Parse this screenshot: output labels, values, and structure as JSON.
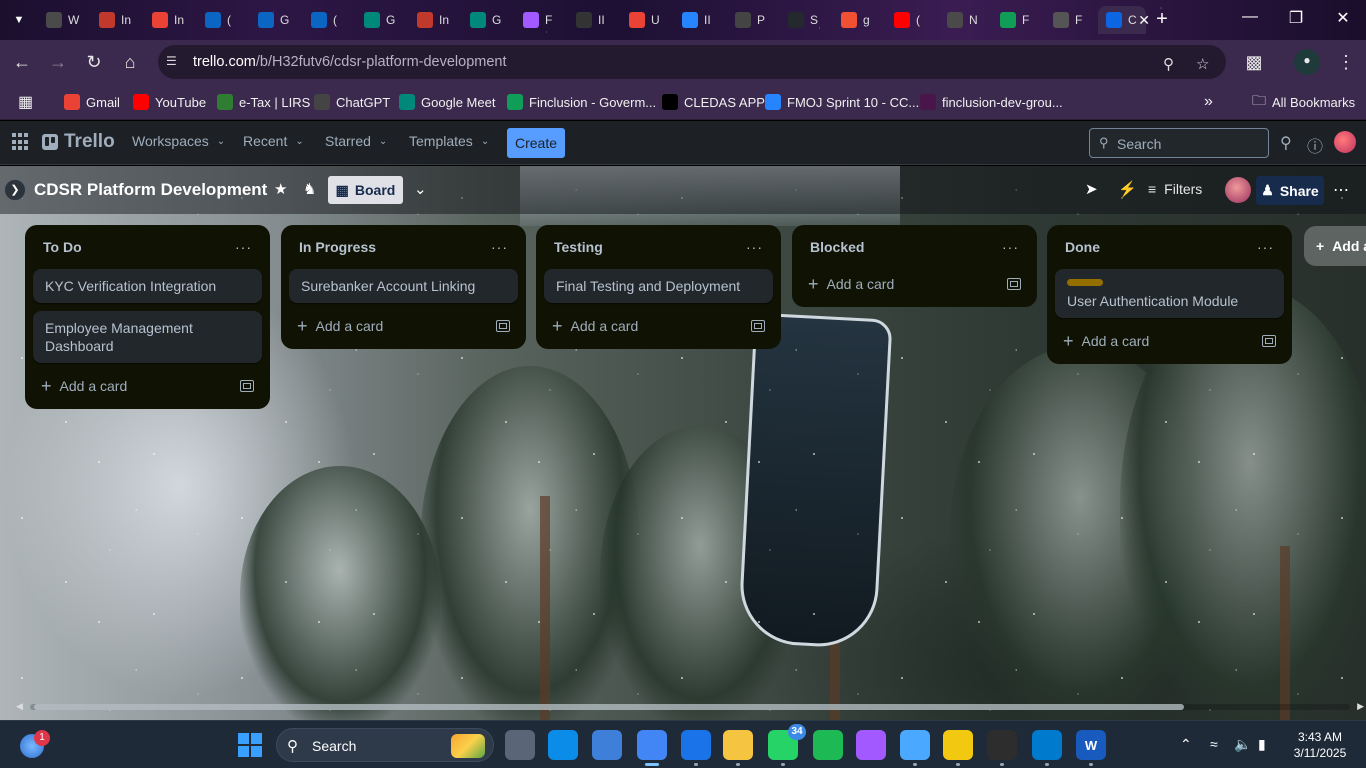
{
  "browser": {
    "tabs": [
      {
        "icon": "chrome-icon",
        "label": "W",
        "color": "#4a4a4a"
      },
      {
        "icon": "speedometer-icon",
        "label": "In",
        "color": "#c0392b"
      },
      {
        "icon": "gmail-icon",
        "label": "In",
        "color": "#ea4335"
      },
      {
        "icon": "linkedin-icon",
        "label": "(",
        "color": "#0a66c2"
      },
      {
        "icon": "linkedin-icon",
        "label": "G",
        "color": "#0a66c2"
      },
      {
        "icon": "linkedin-icon",
        "label": "(",
        "color": "#0a66c2"
      },
      {
        "icon": "google-meet-icon",
        "label": "G",
        "color": "#00897b"
      },
      {
        "icon": "speedometer-icon",
        "label": "In",
        "color": "#c0392b"
      },
      {
        "icon": "google-meet-icon",
        "label": "G",
        "color": "#00897b"
      },
      {
        "icon": "figma-icon",
        "label": "F",
        "color": "#a259ff"
      },
      {
        "icon": "notion-icon",
        "label": "II",
        "color": "#333333"
      },
      {
        "icon": "gmail-icon",
        "label": "U",
        "color": "#ea4335"
      },
      {
        "icon": "jira-icon",
        "label": "II",
        "color": "#2684ff"
      },
      {
        "icon": "openai-icon",
        "label": "P",
        "color": "#444444"
      },
      {
        "icon": "github-icon",
        "label": "S",
        "color": "#24292e"
      },
      {
        "icon": "git-icon",
        "label": "g",
        "color": "#f05133"
      },
      {
        "icon": "youtube-icon",
        "label": "(",
        "color": "#ff0000"
      },
      {
        "icon": "chrome-icon",
        "label": "N",
        "color": "#4a4a4a"
      },
      {
        "icon": "sheets-icon",
        "label": "F",
        "color": "#0f9d58"
      },
      {
        "icon": "trello-icon",
        "label": "F",
        "color": "#555555"
      },
      {
        "icon": "trello-icon",
        "label": "C",
        "color": "#0c66e4"
      }
    ],
    "new_tab_label": "+",
    "url_domain": "trello.com",
    "url_path": "/b/H32futv6/cdsr-platform-development",
    "bookmarks": [
      {
        "icon": "gmail-icon",
        "label": "Gmail",
        "color": "#ea4335"
      },
      {
        "icon": "youtube-icon",
        "label": "YouTube",
        "color": "#ff0000"
      },
      {
        "icon": "etax-icon",
        "label": "e-Tax | LIRS",
        "color": "#2e7d32"
      },
      {
        "icon": "openai-icon",
        "label": "ChatGPT",
        "color": "#444444"
      },
      {
        "icon": "google-meet-icon",
        "label": "Google Meet",
        "color": "#00897b"
      },
      {
        "icon": "sheets-icon",
        "label": "Finclusion - Goverm...",
        "color": "#0f9d58"
      },
      {
        "icon": "vercel-icon",
        "label": "CLEDAS APP",
        "color": "#000000"
      },
      {
        "icon": "jira-icon",
        "label": "FMOJ Sprint 10 - CC...",
        "color": "#2684ff"
      },
      {
        "icon": "slack-icon",
        "label": "finclusion-dev-grou...",
        "color": "#4a154b"
      }
    ],
    "more_bookmarks": "»",
    "all_bookmarks": "All Bookmarks"
  },
  "trello": {
    "logo": "Trello",
    "menu": [
      "Workspaces",
      "Recent",
      "Starred",
      "Templates"
    ],
    "create": "Create",
    "search_placeholder": "Search"
  },
  "board": {
    "title": "CDSR Platform Development",
    "view": "Board",
    "filters": "Filters",
    "share": "Share",
    "add_list": "Add a",
    "lists": [
      {
        "title": "To Do",
        "cards": [
          {
            "title": "KYC Verification Integration",
            "label_color": null
          },
          {
            "title": "Employee Management Dashboard",
            "label_color": null
          }
        ],
        "add_card": "Add a card"
      },
      {
        "title": "In Progress",
        "cards": [
          {
            "title": "Surebanker Account Linking",
            "label_color": null
          }
        ],
        "add_card": "Add a card"
      },
      {
        "title": "Testing",
        "cards": [
          {
            "title": "Final Testing and Deployment",
            "label_color": null
          }
        ],
        "add_card": "Add a card"
      },
      {
        "title": "Blocked",
        "cards": [],
        "add_card": "Add a card"
      },
      {
        "title": "Done",
        "cards": [
          {
            "title": "User Authentication Module",
            "label_color": "#946f00"
          }
        ],
        "add_card": "Add a card"
      }
    ]
  },
  "taskbar": {
    "weather_badge": "1",
    "search": "Search",
    "apps": [
      {
        "icon": "task-view-icon",
        "label": "",
        "color": "#5a6678"
      },
      {
        "icon": "edge-icon",
        "label": "",
        "color": "#0c8ce9"
      },
      {
        "icon": "photos-icon",
        "label": "",
        "color": "#3d7fd9"
      },
      {
        "icon": "chrome-icon",
        "label": "",
        "color": "#4285f4"
      },
      {
        "icon": "chrome-dev-icon",
        "label": "",
        "color": "#1a73e8"
      },
      {
        "icon": "file-explorer-icon",
        "label": "",
        "color": "#f5c542"
      },
      {
        "icon": "whatsapp-icon",
        "label": "",
        "color": "#25d366"
      },
      {
        "icon": "spotify-icon",
        "label": "",
        "color": "#1db954"
      },
      {
        "icon": "figma-icon",
        "label": "",
        "color": "#a259ff"
      },
      {
        "icon": "notepad-icon",
        "label": "",
        "color": "#4aa8ff"
      },
      {
        "icon": "powerbi-icon",
        "label": "",
        "color": "#f2c811"
      },
      {
        "icon": "terminal-icon",
        "label": "",
        "color": "#2d2d2d"
      },
      {
        "icon": "vscode-icon",
        "label": "",
        "color": "#007acc"
      },
      {
        "icon": "word-icon",
        "label": "W",
        "color": "#185abd"
      }
    ],
    "whatsapp_badge": "34",
    "time": "3:43 AM",
    "date": "3/11/2025"
  }
}
